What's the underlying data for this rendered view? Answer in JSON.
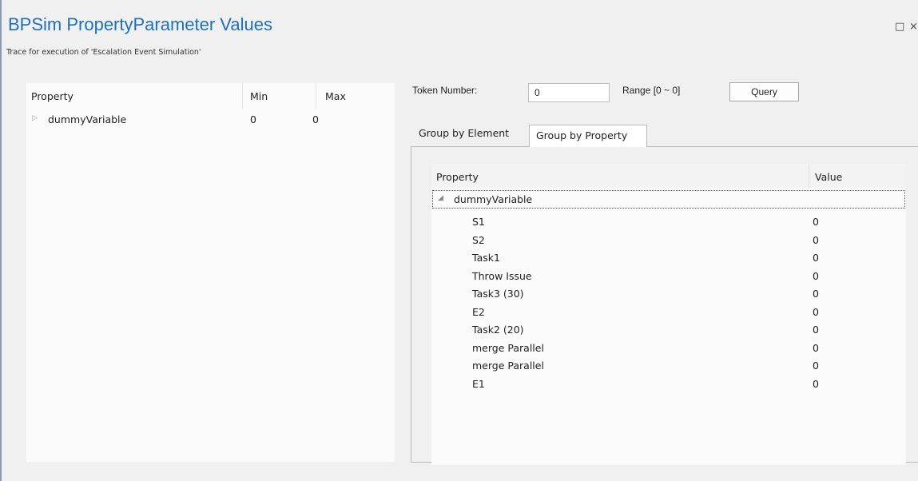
{
  "window": {
    "title": "BPSim PropertyParameter Values",
    "subtitle": "Trace for execution of 'Escalation Event Simulation'",
    "maximize_glyph": "□",
    "close_glyph": "×"
  },
  "left_table": {
    "columns": [
      "Property",
      "Min",
      "Max"
    ],
    "rows": [
      {
        "expander": "▷",
        "property": "dummyVariable",
        "min": "0",
        "max": "0"
      }
    ]
  },
  "token": {
    "label": "Token Number:",
    "value": "0",
    "range_label": "Range [0 ~ 0]",
    "query_label": "Query"
  },
  "tabs": [
    {
      "label": "Group by Element",
      "selected": false
    },
    {
      "label": "Group by Property",
      "selected": true
    }
  ],
  "grid": {
    "columns": [
      "Property",
      "Value"
    ],
    "group": {
      "expander": "◢",
      "label": "dummyVariable"
    },
    "rows": [
      {
        "name": "S1",
        "value": "0"
      },
      {
        "name": "S2",
        "value": "0"
      },
      {
        "name": "Task1",
        "value": "0"
      },
      {
        "name": "Throw Issue",
        "value": "0"
      },
      {
        "name": "Task3 (30)",
        "value": "0"
      },
      {
        "name": "E2",
        "value": "0"
      },
      {
        "name": "Task2 (20)",
        "value": "0"
      },
      {
        "name": "merge Parallel",
        "value": "0"
      },
      {
        "name": "merge Parallel",
        "value": "0"
      },
      {
        "name": "E1",
        "value": "0"
      }
    ]
  },
  "colors": {
    "title": "#1f6fbf",
    "window_bg": "#f0f0f0",
    "panel_bg": "#fbfbfb"
  }
}
